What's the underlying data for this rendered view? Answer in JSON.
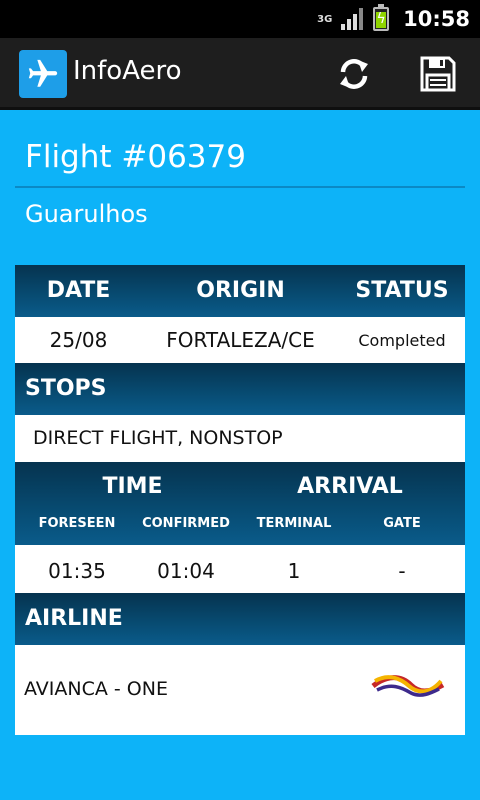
{
  "status_bar": {
    "network": "3G",
    "time": "10:58"
  },
  "app": {
    "title": "InfoAero"
  },
  "flight": {
    "title": "Flight #06379",
    "airport": "Guarulhos"
  },
  "summary": {
    "headers": {
      "date": "DATE",
      "origin": "ORIGIN",
      "status": "STATUS"
    },
    "values": {
      "date": "25/08",
      "origin": "FORTALEZA/CE",
      "status": "Completed"
    }
  },
  "stops": {
    "header": "STOPS",
    "value": "DIRECT FLIGHT, NONSTOP"
  },
  "schedule": {
    "time_header": "TIME",
    "arrival_header": "ARRIVAL",
    "subheaders": {
      "foreseen": "FORESEEN",
      "confirmed": "CONFIRMED",
      "terminal": "TERMINAL",
      "gate": "GATE"
    },
    "values": {
      "foreseen": "01:35",
      "confirmed": "01:04",
      "terminal": "1",
      "gate": "-"
    }
  },
  "airline": {
    "header": "AIRLINE",
    "name": "AVIANCA - ONE",
    "logo": "avianca-logo"
  },
  "icons": {
    "app": "airplane-icon",
    "refresh": "refresh-icon",
    "save": "save-icon"
  },
  "colors": {
    "background": "#0db3f8",
    "header_band": "#074a70",
    "action_bar": "#1e1e1e"
  }
}
